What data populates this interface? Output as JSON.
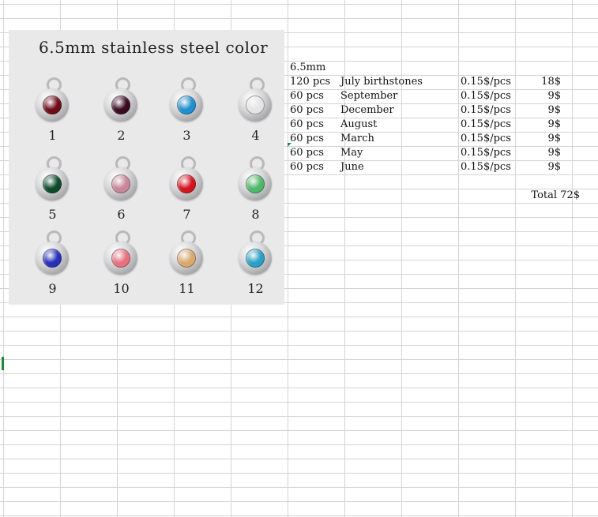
{
  "image": {
    "title": "6.5mm stainless steel color",
    "charms": [
      {
        "number": "1",
        "color": "#6e0c18"
      },
      {
        "number": "2",
        "color": "#3a0a1e"
      },
      {
        "number": "3",
        "color": "#1f8fd0"
      },
      {
        "number": "4",
        "color": "#e4e4e4"
      },
      {
        "number": "5",
        "color": "#0d4a2a"
      },
      {
        "number": "6",
        "color": "#c8869a"
      },
      {
        "number": "7",
        "color": "#d41420"
      },
      {
        "number": "8",
        "color": "#4fb86a"
      },
      {
        "number": "9",
        "color": "#2730b8"
      },
      {
        "number": "10",
        "color": "#e8707e"
      },
      {
        "number": "11",
        "color": "#d9a86e"
      },
      {
        "number": "12",
        "color": "#2aa0c8"
      }
    ]
  },
  "sheet": {
    "header": "6.5mm",
    "rows": [
      {
        "qty": "120 pcs",
        "item": "July birthstones",
        "price": "0.15$/pcs",
        "amount": "18$"
      },
      {
        "qty": "60 pcs",
        "item": "September",
        "price": "0.15$/pcs",
        "amount": "9$"
      },
      {
        "qty": "60 pcs",
        "item": "December",
        "price": "0.15$/pcs",
        "amount": "9$"
      },
      {
        "qty": "60 pcs",
        "item": "August",
        "price": "0.15$/pcs",
        "amount": "9$"
      },
      {
        "qty": "60 pcs",
        "item": "March",
        "price": "0.15$/pcs",
        "amount": "9$"
      },
      {
        "qty": "60 pcs",
        "item": "May",
        "price": "0.15$/pcs",
        "amount": "9$"
      },
      {
        "qty": "60 pcs",
        "item": "June",
        "price": "0.15$/pcs",
        "amount": "9$"
      }
    ],
    "total": "Total 72$"
  }
}
